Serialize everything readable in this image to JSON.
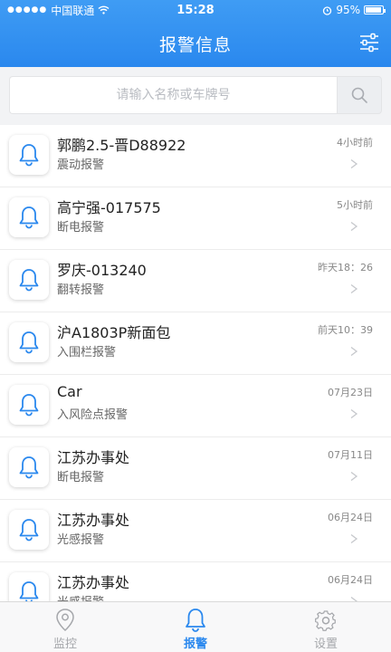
{
  "status_bar": {
    "carrier": "中国联通",
    "time": "15:28",
    "battery": "95%",
    "battery_level": 0.95
  },
  "header": {
    "title": "报警信息",
    "filter_icon": "sliders-icon"
  },
  "search": {
    "placeholder": "请输入名称或车牌号",
    "value": "",
    "icon": "search-icon"
  },
  "alarms": [
    {
      "name": "郭鹏2.5-晋D88922",
      "type": "震动报警",
      "time": "4小时前"
    },
    {
      "name": "高宁强-017575",
      "type": "断电报警",
      "time": "5小时前"
    },
    {
      "name": "罗庆-013240",
      "type": "翻转报警",
      "time": "昨天18：26"
    },
    {
      "name": "沪A1803P新面包",
      "type": "入围栏报警",
      "time": "前天10：39"
    },
    {
      "name": "Car",
      "type": "入风险点报警",
      "time": "07月23日"
    },
    {
      "name": "江苏办事处",
      "type": "断电报警",
      "time": "07月11日"
    },
    {
      "name": "江苏办事处",
      "type": "光感报警",
      "time": "06月24日"
    },
    {
      "name": "江苏办事处",
      "type": "光感报警",
      "time": "06月24日"
    }
  ],
  "tabs": [
    {
      "label": "监控",
      "icon": "location-pin-icon",
      "active": false
    },
    {
      "label": "报警",
      "icon": "bell-icon",
      "active": true
    },
    {
      "label": "设置",
      "icon": "gear-icon",
      "active": false
    }
  ],
  "colors": {
    "primary": "#2a88ee",
    "inactive": "#a5a7ab"
  }
}
